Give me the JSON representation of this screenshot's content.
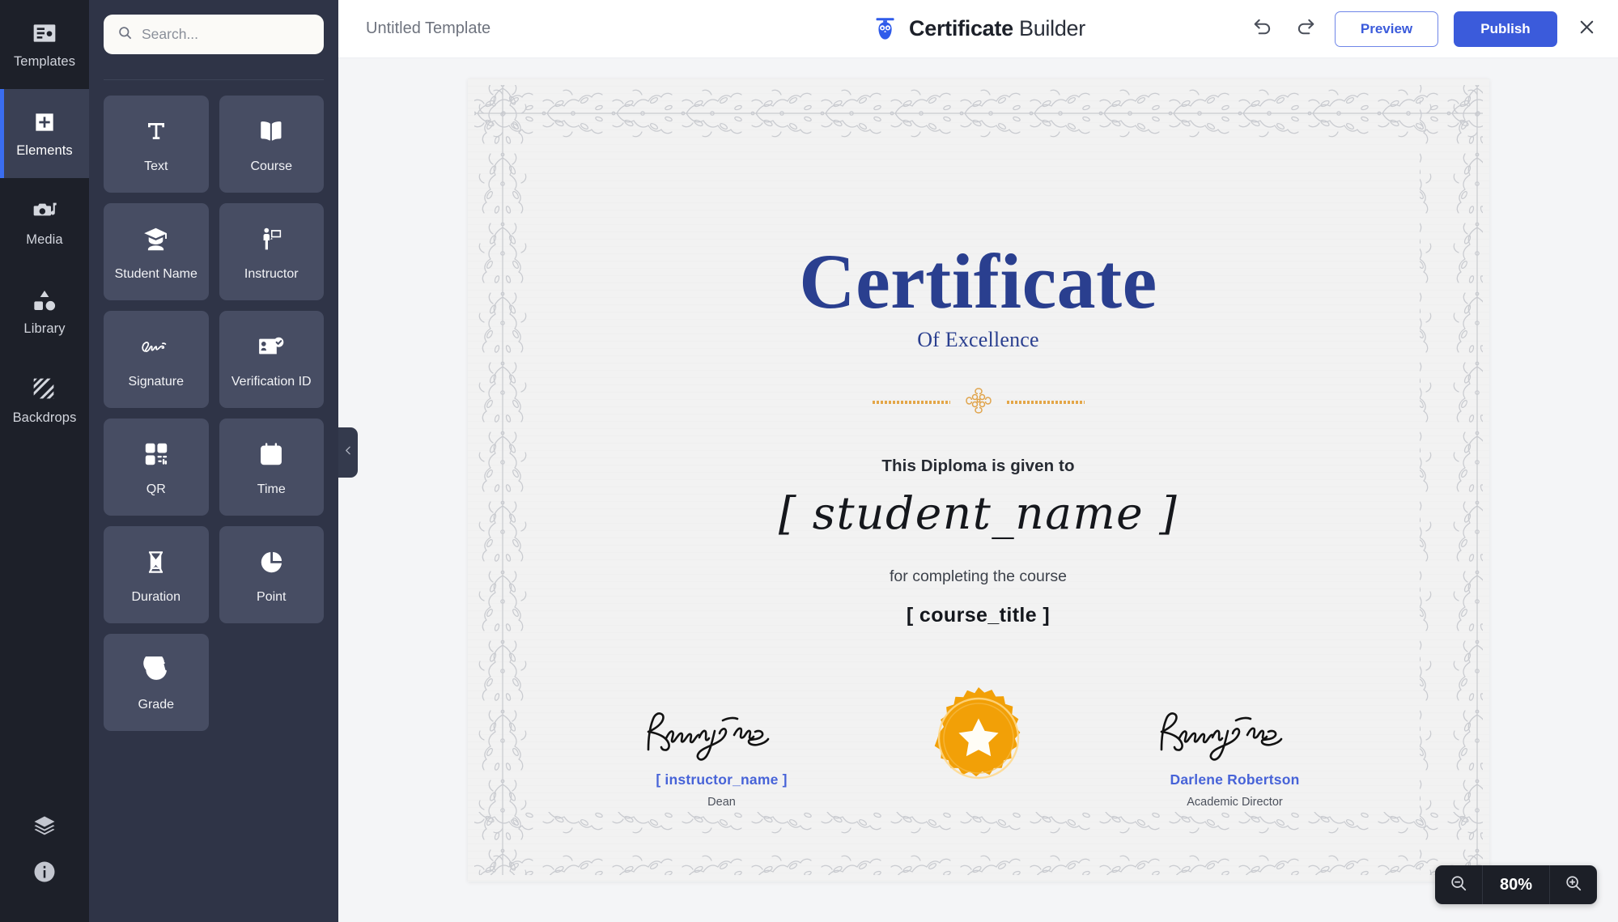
{
  "rail": {
    "items": [
      {
        "label": "Templates",
        "icon": "templates-icon",
        "active": false
      },
      {
        "label": "Elements",
        "icon": "plus-square-icon",
        "active": true
      },
      {
        "label": "Media",
        "icon": "media-icon",
        "active": false
      },
      {
        "label": "Library",
        "icon": "shapes-icon",
        "active": false
      },
      {
        "label": "Backdrops",
        "icon": "backdrops-icon",
        "active": false
      }
    ],
    "bottom": [
      {
        "name": "layers-icon"
      },
      {
        "name": "info-icon"
      }
    ]
  },
  "panel": {
    "search": {
      "value": "",
      "placeholder": "Search...",
      "icon": "search-icon"
    },
    "tiles": [
      {
        "label": "Text",
        "icon": "text-icon"
      },
      {
        "label": "Course",
        "icon": "book-icon"
      },
      {
        "label": "Student Name",
        "icon": "graduate-icon"
      },
      {
        "label": "Instructor",
        "icon": "instructor-icon"
      },
      {
        "label": "Signature",
        "icon": "signature-icon"
      },
      {
        "label": "Verification ID",
        "icon": "id-card-icon"
      },
      {
        "label": "QR",
        "icon": "qr-icon"
      },
      {
        "label": "Time",
        "icon": "calendar-icon"
      },
      {
        "label": "Duration",
        "icon": "hourglass-icon"
      },
      {
        "label": "Point",
        "icon": "pie-chart-icon"
      },
      {
        "label": "Grade",
        "icon": "grade-icon"
      }
    ],
    "collapse_icon": "chevron-left-icon"
  },
  "topbar": {
    "template_name": "Untitled Template",
    "brand_bold": "Certificate",
    "brand_light": "Builder",
    "brand_logo": "owl-graduate-logo",
    "undo_icon": "undo-icon",
    "redo_icon": "redo-icon",
    "preview_label": "Preview",
    "publish_label": "Publish",
    "close_icon": "close-icon"
  },
  "certificate": {
    "title": "Certificate",
    "subtitle": "Of Excellence",
    "given_to": "This Diploma is given to",
    "student_placeholder": "[ student_name ]",
    "for_line": "for completing the course",
    "course_placeholder": "[ course_title ]",
    "seal_icon": "star-seal-icon",
    "signatures": [
      {
        "signature_icon": "handwritten-signature",
        "name": "[ instructor_name ]",
        "role": "Dean"
      },
      {
        "signature_icon": "handwritten-signature",
        "name": "Darlene Robertson",
        "role": "Academic Director"
      }
    ]
  },
  "zoom": {
    "out_icon": "zoom-out-icon",
    "level": "80%",
    "in_icon": "zoom-in-icon"
  },
  "colors": {
    "accent_blue": "#3b5bdb",
    "cert_blue": "#2a3f8f",
    "seal_orange": "#f2a007",
    "rail_bg": "#1d2029",
    "panel_bg": "#2f3447",
    "tile_bg": "#474d63"
  }
}
